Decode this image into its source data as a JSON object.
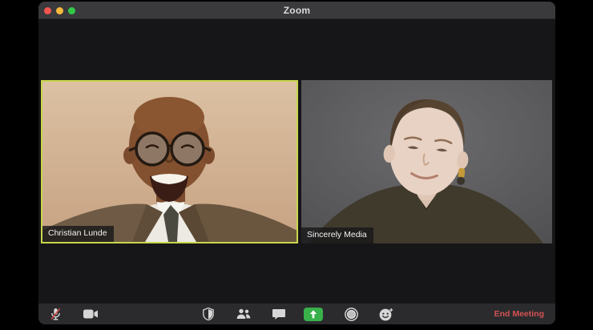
{
  "window": {
    "title": "Zoom"
  },
  "participants": [
    {
      "name": "Christian Lunde",
      "active_speaker": true,
      "video_on": true
    },
    {
      "name": "Sincerely Media",
      "active_speaker": false,
      "video_on": true
    }
  ],
  "toolbar": {
    "icons": [
      {
        "name": "microphone-muted-icon",
        "state": "muted"
      },
      {
        "name": "video-camera-icon",
        "state": "on"
      },
      {
        "name": "security-shield-icon"
      },
      {
        "name": "participants-icon"
      },
      {
        "name": "chat-icon"
      },
      {
        "name": "share-screen-icon"
      },
      {
        "name": "record-icon"
      },
      {
        "name": "reactions-icon"
      }
    ],
    "end_meeting_label": "End Meeting"
  },
  "colors": {
    "active_speaker_border": "#c9d64b",
    "share_screen_green": "#38b14a",
    "muted_slash_red": "#cf4a45",
    "end_meeting_red": "#d35252",
    "titlebar_bg": "#3a3a3d",
    "toolbar_bg": "#2b2b2e",
    "content_bg": "#161618"
  }
}
